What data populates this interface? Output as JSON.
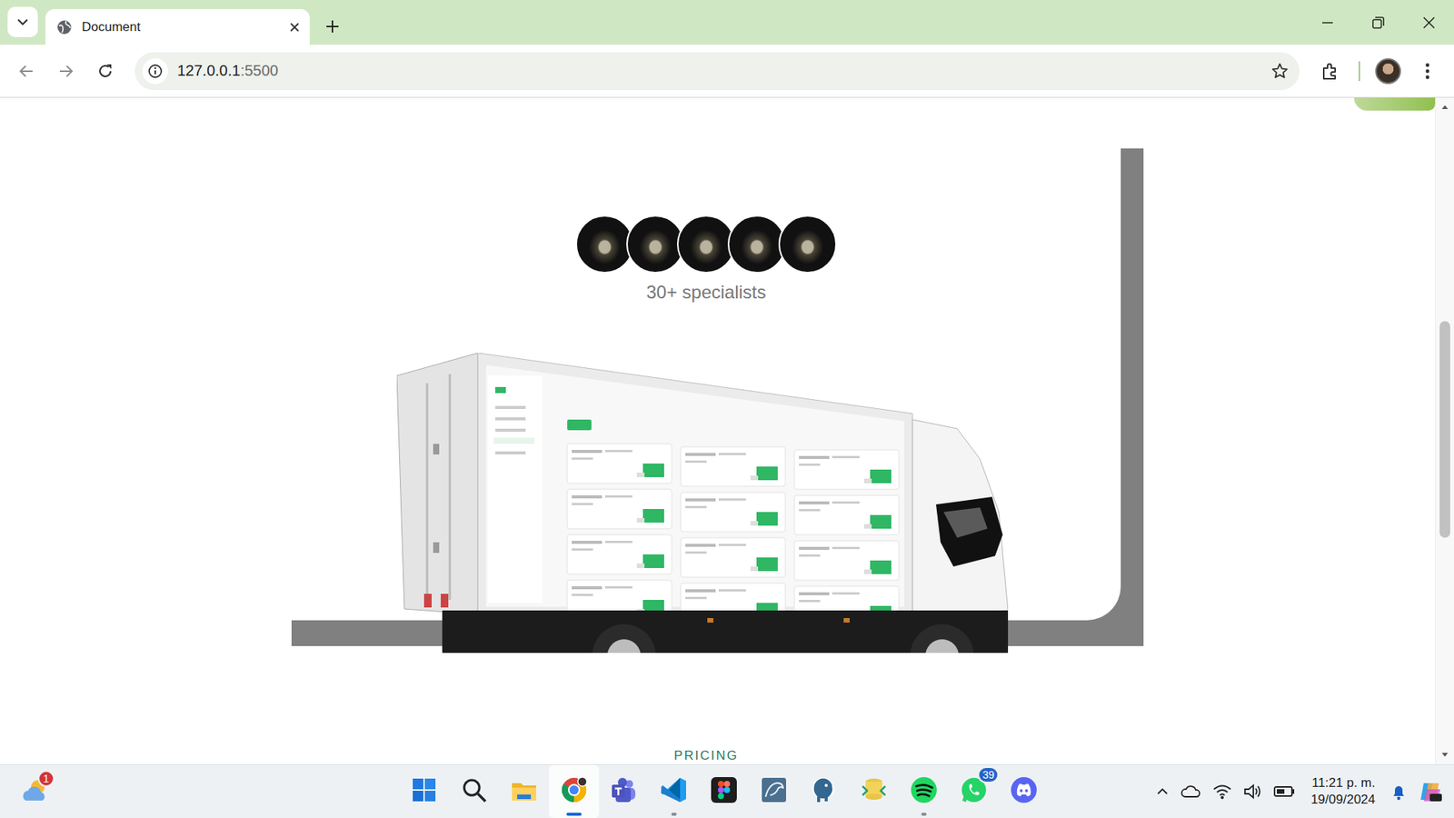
{
  "window": {
    "tabs": [
      {
        "label": "Document",
        "selected": true
      }
    ]
  },
  "address_bar": {
    "host": "127.0.0.1",
    "port": ":5500"
  },
  "page": {
    "avatars": [
      {
        "kind": "photo"
      },
      {
        "kind": "photo"
      },
      {
        "kind": "photo"
      },
      {
        "kind": "photo"
      },
      {
        "kind": "photo"
      }
    ],
    "specialists": "30+ specialists",
    "next_section": "PRICING"
  },
  "taskbar": {
    "weather": {
      "badge": "1"
    },
    "apps": [
      {
        "kind": "start",
        "open": false,
        "selected": false
      },
      {
        "kind": "search",
        "open": false,
        "selected": false
      },
      {
        "kind": "files",
        "open": false,
        "selected": false
      },
      {
        "kind": "chrome",
        "open": true,
        "selected": true
      },
      {
        "kind": "teams",
        "open": false,
        "selected": false
      },
      {
        "kind": "vscode",
        "open": true,
        "selected": false
      },
      {
        "kind": "figma",
        "open": false,
        "selected": false
      },
      {
        "kind": "workbench",
        "open": false,
        "selected": false
      },
      {
        "kind": "postgres",
        "open": false,
        "selected": false
      },
      {
        "kind": "dbtool",
        "open": false,
        "selected": false
      },
      {
        "kind": "spotify",
        "open": true,
        "selected": false
      },
      {
        "kind": "whatsapp",
        "open": false,
        "selected": false,
        "badge": "39"
      },
      {
        "kind": "discord",
        "open": false,
        "selected": false
      }
    ],
    "clock": {
      "time": "11:21 p. m.",
      "date": "19/09/2024"
    }
  }
}
